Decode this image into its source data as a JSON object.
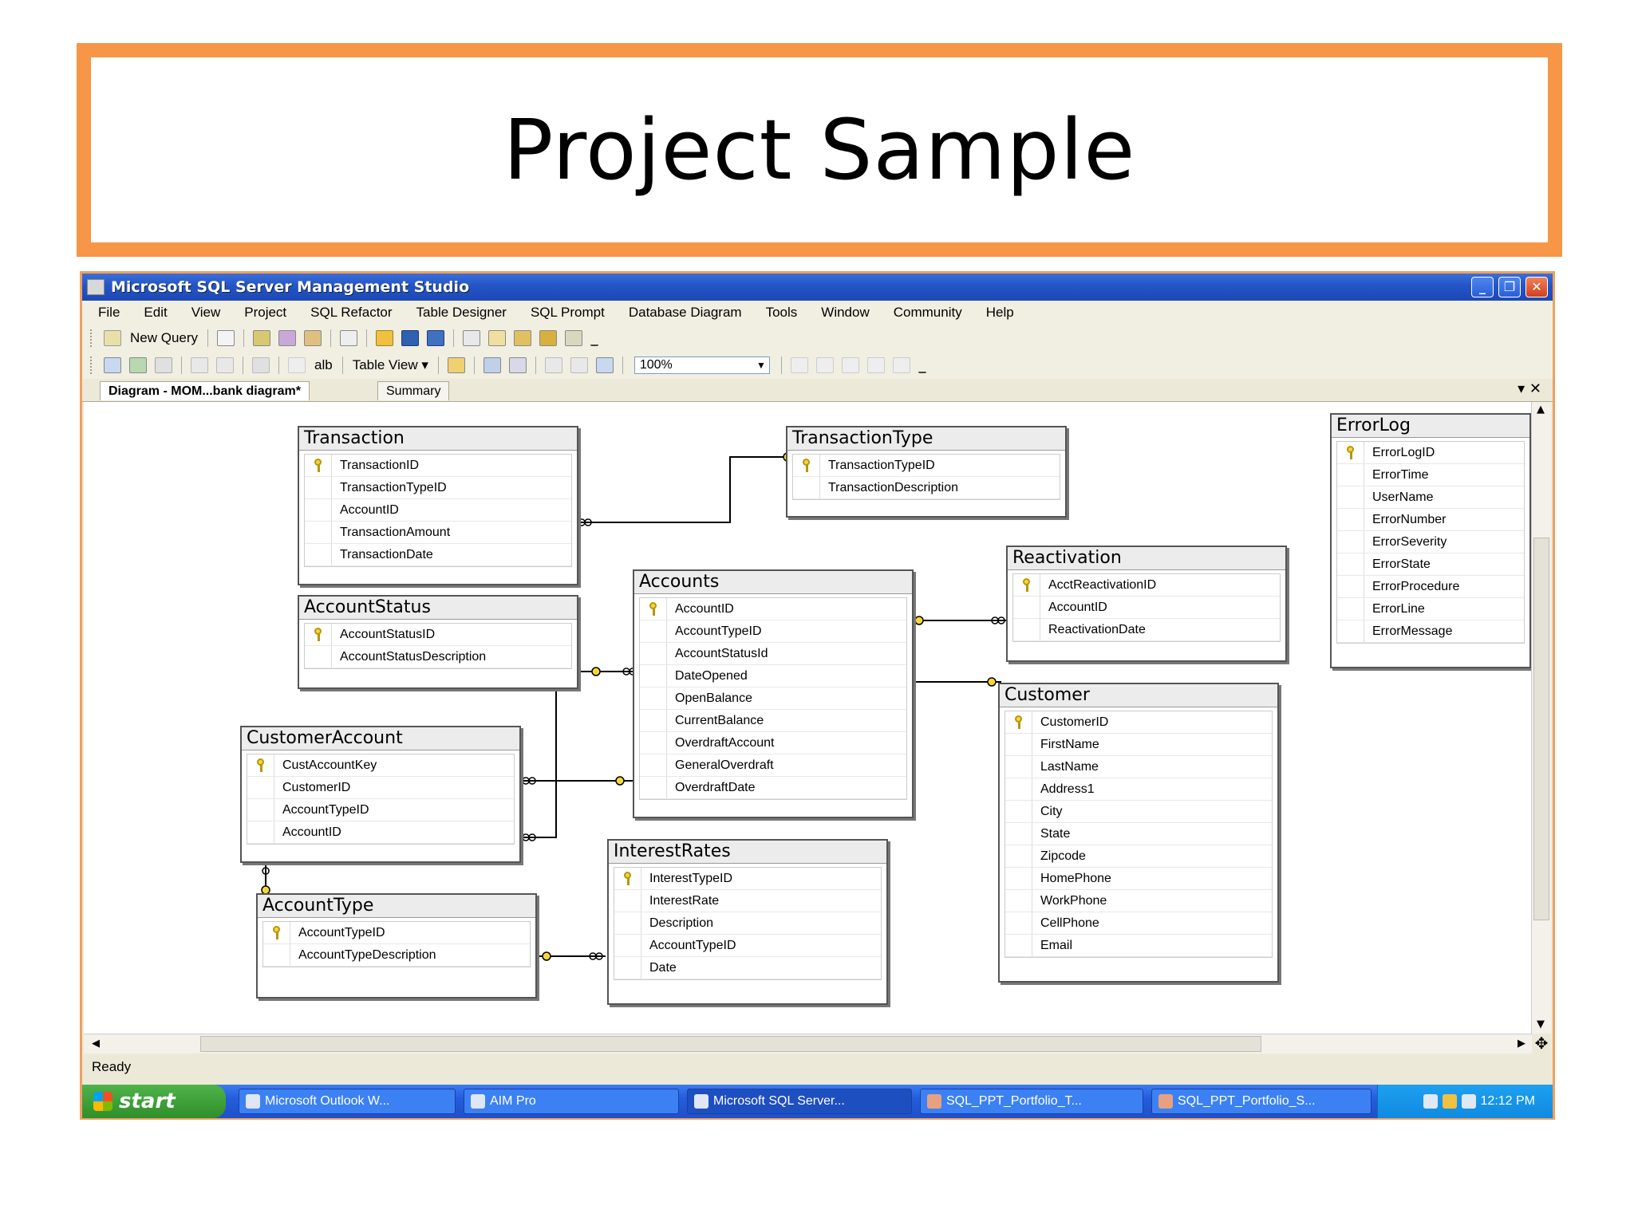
{
  "slide": {
    "title": "Project Sample"
  },
  "window": {
    "title": "Microsoft SQL Server Management Studio",
    "controls": {
      "minimize": "_",
      "restore": "❐",
      "close": "✕"
    }
  },
  "menu": [
    "File",
    "Edit",
    "View",
    "Project",
    "SQL Refactor",
    "Table Designer",
    "SQL Prompt",
    "Database Diagram",
    "Tools",
    "Window",
    "Community",
    "Help"
  ],
  "toolbar1": {
    "new_query": "New Query"
  },
  "toolbar2": {
    "font_label": "alb",
    "table_view": "Table View ▾",
    "zoom": "100%"
  },
  "tabs": {
    "active": "Diagram - MOM...bank diagram*",
    "inactive": "Summary",
    "controls": "▾ ✕"
  },
  "tables": [
    {
      "name": "Transaction",
      "key": "TransactionID",
      "columns": [
        "TransactionTypeID",
        "AccountID",
        "TransactionAmount",
        "TransactionDate"
      ]
    },
    {
      "name": "TransactionType",
      "key": "TransactionTypeID",
      "columns": [
        "TransactionDescription"
      ]
    },
    {
      "name": "ErrorLog",
      "key": "ErrorLogID",
      "columns": [
        "ErrorTime",
        "UserName",
        "ErrorNumber",
        "ErrorSeverity",
        "ErrorState",
        "ErrorProcedure",
        "ErrorLine",
        "ErrorMessage"
      ]
    },
    {
      "name": "Reactivation",
      "key": "AcctReactivationID",
      "columns": [
        "AccountID",
        "ReactivationDate"
      ]
    },
    {
      "name": "Accounts",
      "key": "AccountID",
      "columns": [
        "AccountTypeID",
        "AccountStatusId",
        "DateOpened",
        "OpenBalance",
        "CurrentBalance",
        "OverdraftAccount",
        "GeneralOverdraft",
        "OverdraftDate"
      ]
    },
    {
      "name": "AccountStatus",
      "key": "AccountStatusID",
      "columns": [
        "AccountStatusDescription"
      ]
    },
    {
      "name": "Customer",
      "key": "CustomerID",
      "columns": [
        "FirstName",
        "LastName",
        "Address1",
        "City",
        "State",
        "Zipcode",
        "HomePhone",
        "WorkPhone",
        "CellPhone",
        "Email"
      ]
    },
    {
      "name": "CustomerAccount",
      "key": "CustAccountKey",
      "columns": [
        "CustomerID",
        "AccountTypeID",
        "AccountID"
      ]
    },
    {
      "name": "InterestRates",
      "key": "InterestTypeID",
      "columns": [
        "InterestRate",
        "Description",
        "AccountTypeID",
        "Date"
      ]
    },
    {
      "name": "AccountType",
      "key": "AccountTypeID",
      "columns": [
        "AccountTypeDescription"
      ]
    }
  ],
  "status": {
    "text": "Ready"
  },
  "taskbar": {
    "start": "start",
    "items": [
      "Microsoft Outlook W...",
      "AIM Pro",
      "Microsoft SQL Server...",
      "SQL_PPT_Portfolio_T...",
      "SQL_PPT_Portfolio_S..."
    ],
    "clock": "12:12 PM"
  },
  "colors": {
    "accent_border": "#f79646",
    "title_bar": "#2454c4",
    "start_button": "#3c9a36",
    "key_icon": "#f5d838"
  }
}
